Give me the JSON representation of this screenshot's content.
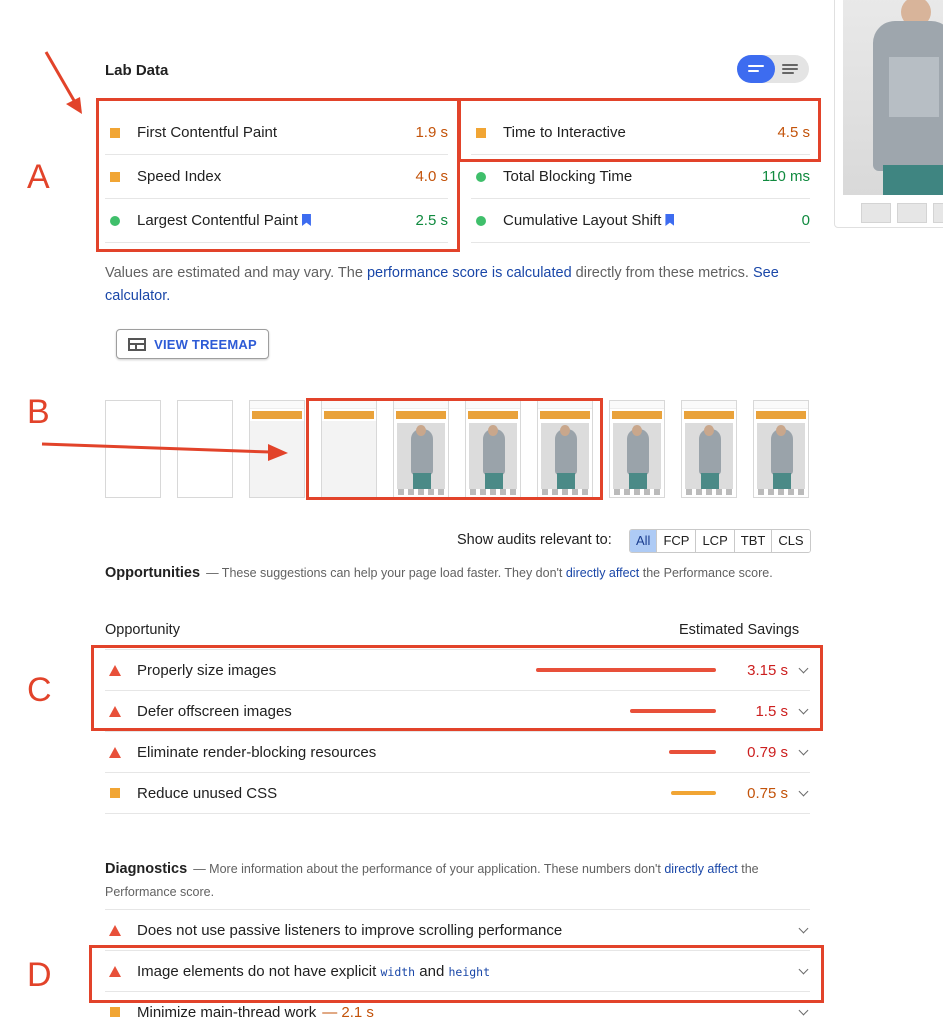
{
  "lab_data": {
    "title": "Lab Data",
    "metrics_left": [
      {
        "label": "First Contentful Paint",
        "value": "1.9 s",
        "status": "average",
        "bookmark": false
      },
      {
        "label": "Speed Index",
        "value": "4.0 s",
        "status": "average",
        "bookmark": false
      },
      {
        "label": "Largest Contentful Paint",
        "value": "2.5 s",
        "status": "pass",
        "bookmark": true
      }
    ],
    "metrics_right": [
      {
        "label": "Time to Interactive",
        "value": "4.5 s",
        "status": "average",
        "bookmark": false
      },
      {
        "label": "Total Blocking Time",
        "value": "110 ms",
        "status": "pass",
        "bookmark": false
      },
      {
        "label": "Cumulative Layout Shift",
        "value": "0",
        "status": "pass",
        "bookmark": true
      }
    ],
    "note": {
      "prefix": "Values are estimated and may vary. The ",
      "link1": "performance score is calculated",
      "middle": " directly from these metrics. ",
      "link2": "See calculator."
    },
    "treemap_button": "VIEW TREEMAP"
  },
  "filter": {
    "label": "Show audits relevant to:",
    "chips": [
      "All",
      "FCP",
      "LCP",
      "TBT",
      "CLS"
    ],
    "active": "All"
  },
  "opportunities": {
    "title": "Opportunities",
    "desc_prefix": "— These suggestions can help your page load faster. They don't ",
    "desc_link": "directly affect",
    "desc_suffix": " the Performance score.",
    "col_left": "Opportunity",
    "col_right": "Estimated Savings",
    "items": [
      {
        "label": "Properly size images",
        "value": "3.15 s",
        "severity": "fail",
        "savings_fraction": 1.0
      },
      {
        "label": "Defer offscreen images",
        "value": "1.5 s",
        "severity": "fail",
        "savings_fraction": 0.48
      },
      {
        "label": "Eliminate render-blocking resources",
        "value": "0.79 s",
        "severity": "fail",
        "savings_fraction": 0.26
      },
      {
        "label": "Reduce unused CSS",
        "value": "0.75 s",
        "severity": "average",
        "savings_fraction": 0.25
      }
    ]
  },
  "diagnostics": {
    "title": "Diagnostics",
    "desc_prefix": "— More information about the performance of your application. These numbers don't ",
    "desc_link": "directly affect",
    "desc_suffix": " the Performance score.",
    "items": [
      {
        "label": "Does not use passive listeners to improve scrolling performance",
        "severity": "fail"
      },
      {
        "label_prefix": "Image elements do not have explicit ",
        "code1": "width",
        "label_mid": " and ",
        "code2": "height",
        "severity": "fail"
      },
      {
        "label": "Minimize main-thread work",
        "threshold": "— 2.1 s",
        "severity": "average"
      }
    ]
  },
  "annotations": {
    "a": "A",
    "b": "B",
    "c": "C",
    "d": "D"
  },
  "colors": {
    "accent_blue": "#3d6cf0",
    "fail_red": "#e8503a",
    "average_orange": "#f1a534",
    "pass_green": "#3fbf6b",
    "annotation_red": "#e2432a"
  }
}
